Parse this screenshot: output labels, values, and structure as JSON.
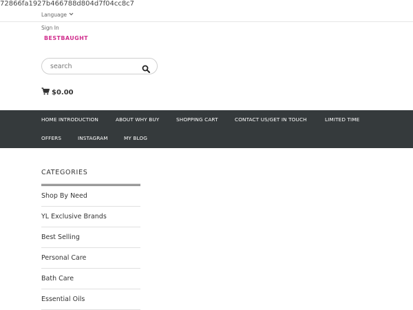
{
  "hash_text": "72866fa1927b466788d804d7f04cc8c7",
  "header": {
    "language_label": "Language",
    "sign_in": "Sign In",
    "logo_text": "BESTBAUGHT",
    "search_placeholder": "search",
    "cart_total": "$0.00"
  },
  "nav": {
    "items": [
      "HOME INTRODUCTION",
      "ABOUT WHY BUY",
      "SHOPPING CART",
      "CONTACT US/GET IN TOUCH",
      "LIMITED TIME",
      "OFFERS",
      "INSTAGRAM",
      "MY BLOG"
    ]
  },
  "categories": {
    "title": "CATEGORIES",
    "items": [
      "Shop By Need",
      "YL Exclusive Brands",
      "Best Selling",
      "Personal Care",
      "Bath Care",
      "Essential Oils"
    ]
  },
  "colors": {
    "nav_background": "#353a3c",
    "logo": "#d12f8e"
  },
  "icons": {
    "language": "chevron-down-icon",
    "search": "search-icon",
    "cart": "cart-icon"
  }
}
